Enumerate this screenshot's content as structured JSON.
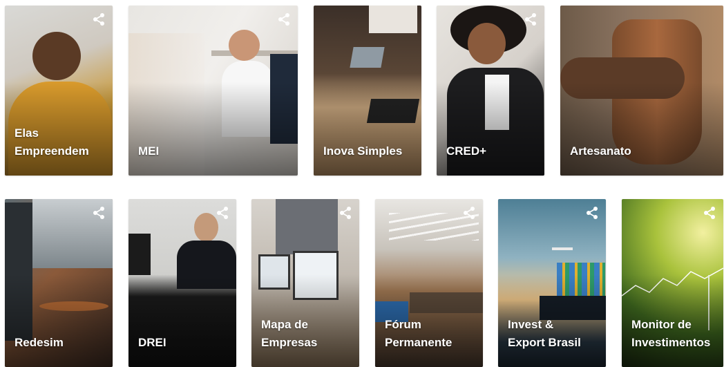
{
  "cards_row1": [
    {
      "label": "Elas\nEmpreendem",
      "icon": "share-icon"
    },
    {
      "label": "MEI",
      "icon": "share-icon"
    },
    {
      "label": "Inova Simples",
      "icon": "share-icon"
    },
    {
      "label": "CRED+",
      "icon": "share-icon"
    },
    {
      "label": "Artesanato",
      "icon": "share-icon"
    }
  ],
  "cards_row2": [
    {
      "label": "Redesim",
      "icon": "share-icon"
    },
    {
      "label": "DREI",
      "icon": "share-icon"
    },
    {
      "label": "Mapa de\nEmpresas",
      "icon": "share-icon"
    },
    {
      "label": "Fórum\nPermanente",
      "icon": "share-icon"
    },
    {
      "label": "Invest &\nExport Brasil",
      "icon": "share-icon"
    },
    {
      "label": "Monitor de\nInvestimentos",
      "icon": "share-icon"
    }
  ],
  "colors": {
    "label_text": "#ffffff",
    "page_background": "#ffffff"
  }
}
